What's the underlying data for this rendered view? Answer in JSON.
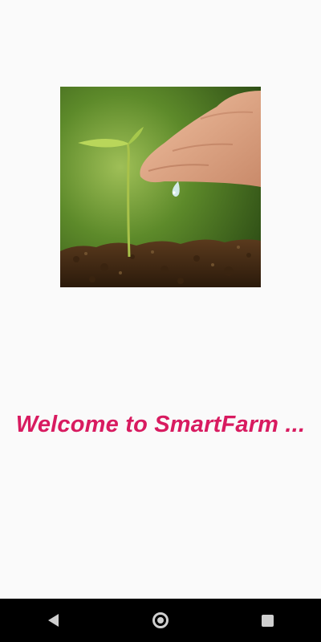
{
  "app": {
    "welcome_text": "Welcome to SmartFarm ...",
    "accent_color": "#d81b60",
    "background_color": "#fafafa"
  },
  "hero_image": {
    "icon": "seedling-water-drop-image"
  },
  "navigation_bar": {
    "background_color": "#000000",
    "buttons": [
      {
        "icon": "back-icon"
      },
      {
        "icon": "home-icon"
      },
      {
        "icon": "recents-icon"
      }
    ]
  }
}
